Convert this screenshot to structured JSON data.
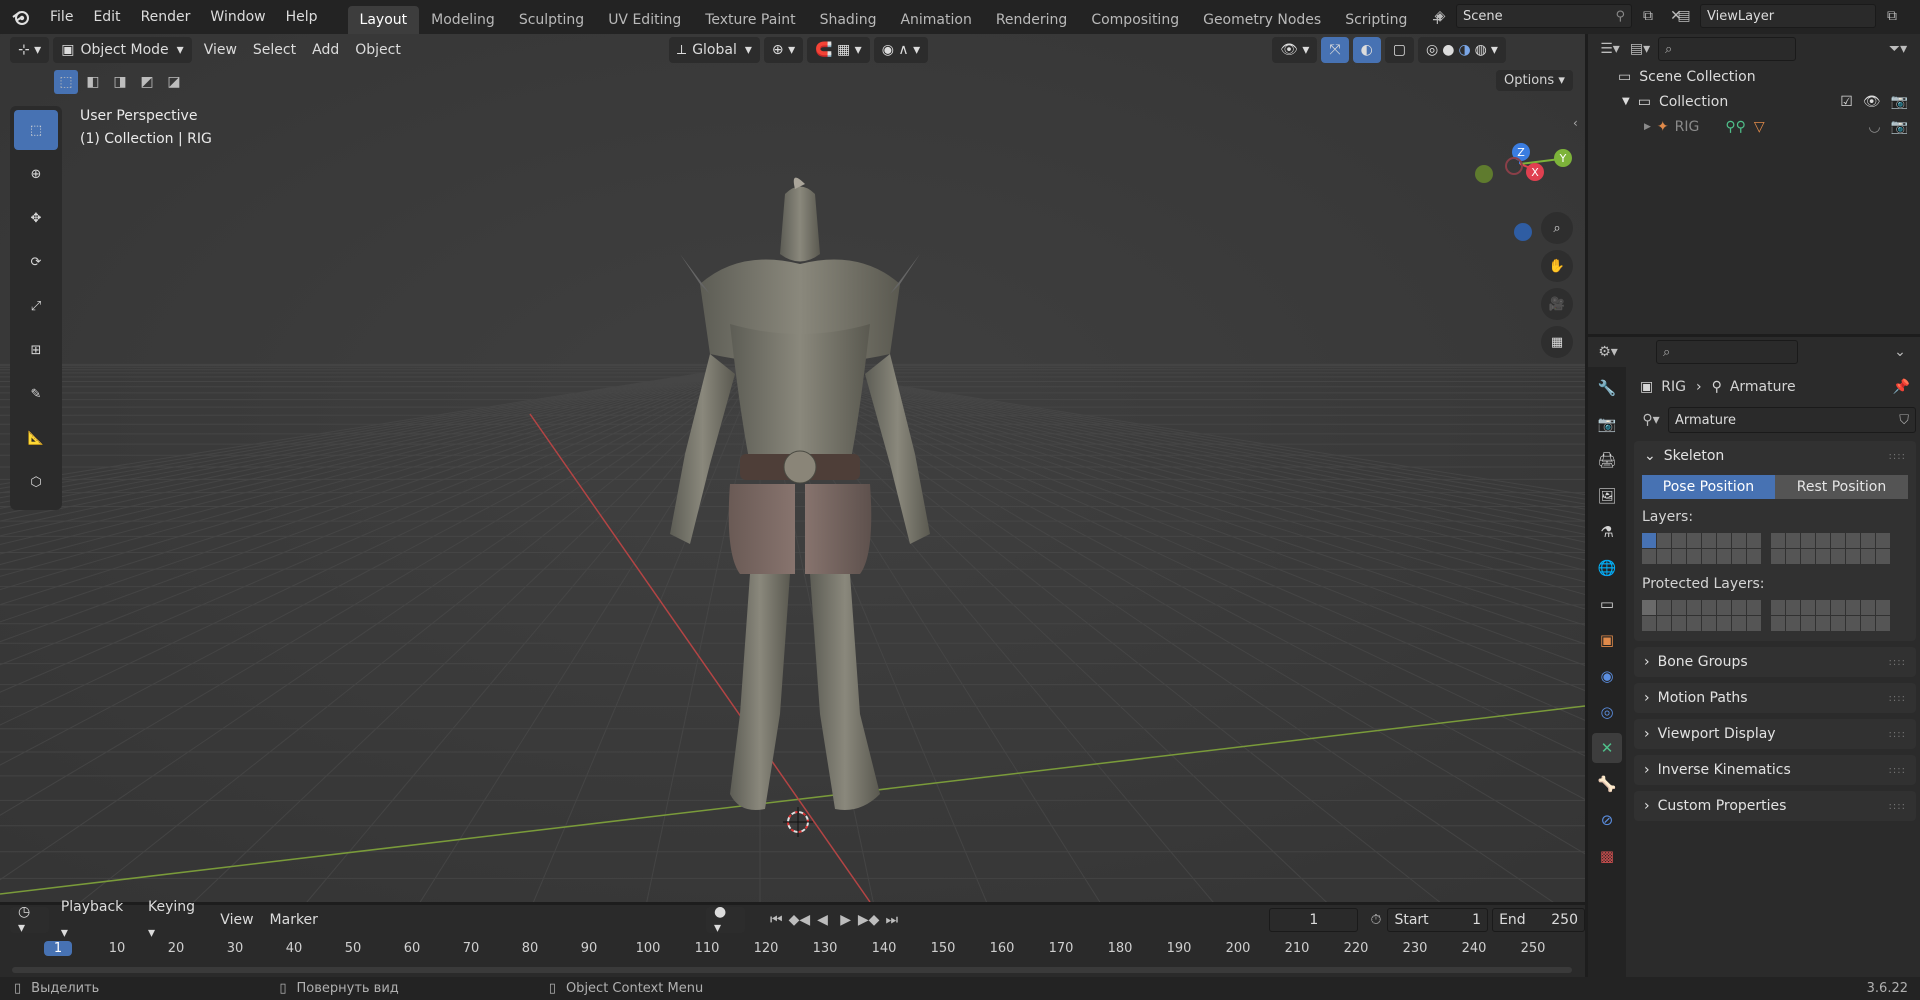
{
  "topbar": {
    "menus": [
      "File",
      "Edit",
      "Render",
      "Window",
      "Help"
    ],
    "workspaces": [
      "Layout",
      "Modeling",
      "Sculpting",
      "UV Editing",
      "Texture Paint",
      "Shading",
      "Animation",
      "Rendering",
      "Compositing",
      "Geometry Nodes",
      "Scripting"
    ],
    "active_workspace": "Layout",
    "add_tab": "+",
    "scene": "Scene",
    "view_layer": "ViewLayer"
  },
  "viewport": {
    "mode": "Object Mode",
    "menus": [
      "View",
      "Select",
      "Add",
      "Object"
    ],
    "transform_orientation": "Global",
    "options_label": "Options",
    "perspective_label": "User Perspective",
    "collection_label": "(1) Collection | RIG",
    "gizmo": {
      "x": "X",
      "y": "Y",
      "z": "Z"
    }
  },
  "outliner": {
    "scene_collection": "Scene Collection",
    "collection": "Collection",
    "rig": "RIG"
  },
  "properties": {
    "breadcrumb_object": "RIG",
    "breadcrumb_data": "Armature",
    "data_name": "Armature",
    "skeleton": {
      "title": "Skeleton",
      "pose_position": "Pose Position",
      "rest_position": "Rest Position",
      "layers_label": "Layers:",
      "protected_label": "Protected Layers:"
    },
    "panels": [
      "Bone Groups",
      "Motion Paths",
      "Viewport Display",
      "Inverse Kinematics",
      "Custom Properties"
    ]
  },
  "timeline": {
    "menus": [
      "Playback",
      "Keying",
      "View",
      "Marker"
    ],
    "current_frame": "1",
    "start_label": "Start",
    "start_value": "1",
    "end_label": "End",
    "end_value": "250",
    "ticks": [
      "1",
      "10",
      "20",
      "30",
      "40",
      "50",
      "60",
      "70",
      "80",
      "90",
      "100",
      "110",
      "120",
      "130",
      "140",
      "150",
      "160",
      "170",
      "180",
      "190",
      "200",
      "210",
      "220",
      "230",
      "240",
      "250"
    ]
  },
  "status": {
    "select": "Выделить",
    "rotate": "Повернуть вид",
    "context": "Object Context Menu",
    "version": "3.6.22"
  }
}
